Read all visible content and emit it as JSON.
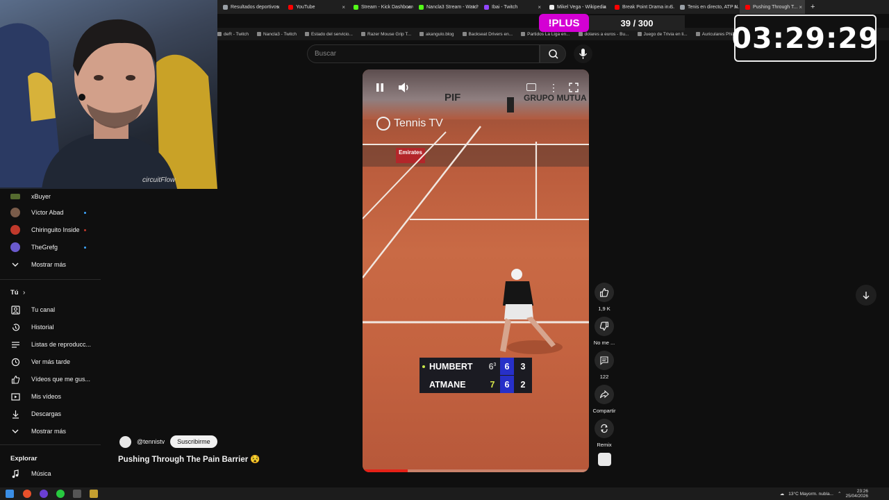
{
  "browser": {
    "tabs": [
      {
        "label": "Resultados deportivos",
        "color": "#9aa0a6"
      },
      {
        "label": "YouTube",
        "color": "#ff0000"
      },
      {
        "label": "Stream - Kick Dashboard",
        "color": "#53fc18"
      },
      {
        "label": "Nancla3 Stream - Watch",
        "color": "#53fc18"
      },
      {
        "label": "Ibai - Twitch",
        "color": "#9146ff"
      },
      {
        "label": "Mikel Vega - Wikipedia",
        "color": "#eeeeee"
      },
      {
        "label": "Break Point Drama in S...",
        "color": "#ff0000"
      },
      {
        "label": "Tenis en directo, ATP N...",
        "color": "#9aa0a6"
      },
      {
        "label": "Pushing Through T...",
        "color": "#ff0000"
      }
    ],
    "bookmarks": [
      "deR - Twitch",
      "Nancla3 - Twitch",
      "Estado del servicio...",
      "Razer Mouse Grip T...",
      "akangulo.blog",
      "Backseat Drivers en...",
      "Partidos La Liga en...",
      "dolares a euros - Bu...",
      "Juego de Trivia en li...",
      "Auriculares Philips |..."
    ]
  },
  "overlay": {
    "plus_label": "!PLUS",
    "plus_count": "39 / 300",
    "timer": "03:29:29"
  },
  "search": {
    "placeholder": "Buscar"
  },
  "sidebar": {
    "subscriptions": [
      {
        "label": "xBuyer",
        "color": "#556b2f",
        "dot": false
      },
      {
        "label": "Víctor Abad",
        "color": "#7a5c4a",
        "dot": true
      },
      {
        "label": "Chiringuito Inside",
        "color": "#c0392b",
        "dot": true
      },
      {
        "label": "TheGrefg",
        "color": "#6a5acd",
        "dot": true
      }
    ],
    "show_more_1": "Mostrar más",
    "you_heading": "Tú",
    "you_items": [
      {
        "label": "Tu canal",
        "icon": "account-box-icon"
      },
      {
        "label": "Historial",
        "icon": "history-icon"
      },
      {
        "label": "Listas de reproducc...",
        "icon": "playlist-icon"
      },
      {
        "label": "Ver más tarde",
        "icon": "clock-icon"
      },
      {
        "label": "Vídeos que me gus...",
        "icon": "thumb-up-icon"
      },
      {
        "label": "Mis vídeos",
        "icon": "video-icon"
      },
      {
        "label": "Descargas",
        "icon": "download-icon"
      }
    ],
    "show_more_2": "Mostrar más",
    "explore_heading": "Explorar",
    "music_label": "Música"
  },
  "video": {
    "watermark": "Tennis TV",
    "sponsor": "Emirates",
    "banner_left": "PIF",
    "banner_right": "GRUPO MUTUA",
    "scoreboard": {
      "players": [
        {
          "name": "HUMBERT",
          "set1": "6",
          "set1_tb": "3",
          "set2": "6",
          "set3": "3",
          "serving": true
        },
        {
          "name": "ATMANE",
          "set1": "7",
          "set1_tb": "",
          "set2": "6",
          "set3": "2",
          "serving": false
        }
      ]
    },
    "progress_fraction": 0.2
  },
  "actions": {
    "likes": "1,9 K",
    "dislike_label": "No me ...",
    "comments": "122",
    "share_label": "Compartir",
    "remix_label": "Remix"
  },
  "channel": {
    "handle": "@tennistv",
    "subscribe_label": "Suscribirme",
    "title": "Pushing Through The Pain Barrier 😵"
  },
  "taskbar": {
    "weather": "13°C  Mayorm. nubla...",
    "time": "23:26",
    "date": "25/04/2026"
  },
  "colors": {
    "accent_plus": "#d400d4",
    "scoreboard_blue": "#2730c8",
    "progress_red": "#e62117"
  }
}
